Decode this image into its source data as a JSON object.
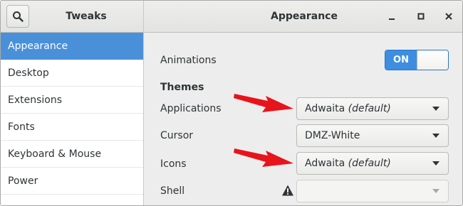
{
  "header": {
    "app_title": "Tweaks",
    "panel_title": "Appearance"
  },
  "icons": {
    "search": "search-icon",
    "minimize": "minimize-icon",
    "maximize": "maximize-icon",
    "close": "close-icon",
    "dropdown": "chevron-down-icon",
    "warning": "warning-icon",
    "annotation": "red-arrow"
  },
  "sidebar": {
    "items": [
      {
        "label": "Appearance",
        "active": true
      },
      {
        "label": "Desktop"
      },
      {
        "label": "Extensions"
      },
      {
        "label": "Fonts"
      },
      {
        "label": "Keyboard & Mouse"
      },
      {
        "label": "Power"
      }
    ]
  },
  "main": {
    "animations": {
      "label": "Animations",
      "switch_text": "ON",
      "state": true
    },
    "themes_heading": "Themes",
    "applications": {
      "label": "Applications",
      "value": "Adwaita",
      "value_note": "(default)"
    },
    "cursor": {
      "label": "Cursor",
      "value": "DMZ-White"
    },
    "icons": {
      "label": "Icons",
      "value": "Adwaita",
      "value_note": "(default)"
    },
    "shell": {
      "label": "Shell",
      "value": ""
    }
  },
  "colors": {
    "accent": "#4a90d9",
    "switch_on": "#3d8ee0",
    "annotation_arrow": "#e8141b"
  }
}
